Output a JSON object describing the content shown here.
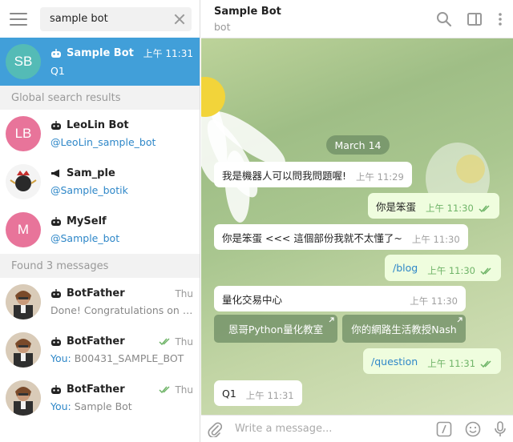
{
  "search": {
    "value": "sample bot"
  },
  "active_chat": {
    "avatar_initials": "SB",
    "avatar_color": "#54bbb6",
    "name": "Sample Bot",
    "time": "上午 11:31",
    "last_message": "Q1"
  },
  "global_section": "Global search results",
  "global_results": [
    {
      "avatar_initials": "LB",
      "avatar_color": "#e8749a",
      "name": "LeoLin Bot",
      "handle": "@LeoLin_sample_bot",
      "icon": "bot-icon"
    },
    {
      "avatar_initials": "",
      "avatar_color": "#f4f4f4",
      "name": "Sam_ple",
      "handle": "@Sample_botik",
      "icon": "megaphone-icon"
    },
    {
      "avatar_initials": "M",
      "avatar_color": "#e8749a",
      "name": "MySelf",
      "handle": "@Sample_bot",
      "icon": "bot-icon"
    }
  ],
  "messages_section": "Found 3 messages",
  "found_messages": [
    {
      "name": "BotFather",
      "time": "Thu",
      "prefix": "",
      "text": "Done! Congratulations on yo...",
      "read": false
    },
    {
      "name": "BotFather",
      "time": "Thu",
      "prefix": "You: ",
      "text": "B00431_SAMPLE_BOT",
      "read": true
    },
    {
      "name": "BotFather",
      "time": "Thu",
      "prefix": "You: ",
      "text": "Sample Bot",
      "read": true
    }
  ],
  "header": {
    "title": "Sample Bot",
    "status": "bot"
  },
  "date_label": "March 14",
  "chat_messages": [
    {
      "dir": "in",
      "text": "我是機器人可以問我問題喔!",
      "time": "上午 11:29"
    },
    {
      "dir": "out",
      "text": "你是笨蛋",
      "time": "上午 11:30"
    },
    {
      "dir": "in",
      "text": "你是笨蛋 <<< 這個部份我就不太懂了~",
      "time": "上午 11:30"
    },
    {
      "dir": "out",
      "text": "/blog",
      "time": "上午 11:30",
      "link": true
    },
    {
      "dir": "in",
      "text": "量化交易中心",
      "time": "上午 11:30"
    },
    {
      "dir": "out",
      "text": "/question",
      "time": "上午 11:31",
      "link": true
    },
    {
      "dir": "in",
      "text": "Q1",
      "time": "上午 11:31"
    }
  ],
  "inline_buttons": [
    "恩哥Python量化教室",
    "你的網路生活教授Nash"
  ],
  "composer": {
    "placeholder": "Write a message..."
  },
  "colors": {
    "accent": "#419fd9",
    "link": "#2e87c8",
    "out_bubble": "#effdde",
    "read_check": "#6fb468"
  }
}
